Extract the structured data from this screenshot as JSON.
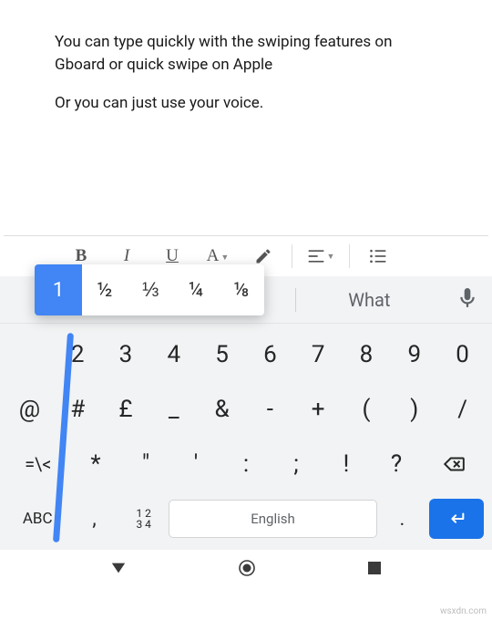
{
  "document": {
    "para1": "You can type quickly with the swiping features on Gboard or quick swipe on Apple",
    "para2": "Or you can just use your voice."
  },
  "format_toolbar": {
    "bold": "B",
    "italic": "I",
    "underline": "U",
    "text_color": "A"
  },
  "long_press_popup": {
    "primary": "1",
    "options": [
      "½",
      "⅓",
      "¼",
      "⅛"
    ]
  },
  "suggestions": {
    "left": "",
    "middle": "",
    "right": "What"
  },
  "keyboard": {
    "row1": [
      "1",
      "2",
      "3",
      "4",
      "5",
      "6",
      "7",
      "8",
      "9",
      "0"
    ],
    "row2": [
      "@",
      "#",
      "£",
      "_",
      "&",
      "-",
      "+",
      "(",
      ")",
      "/"
    ],
    "row3_shift": "=\\<",
    "row3": [
      "*",
      "\"",
      "'",
      ":",
      ";",
      "!",
      "?"
    ],
    "row4_mode": "ABC",
    "row4_comma": ",",
    "row4_numbers_top": "1 2",
    "row4_numbers_bottom": "3 4",
    "spacebar": "English",
    "row4_period": "."
  },
  "watermark": "wsxdn.com"
}
